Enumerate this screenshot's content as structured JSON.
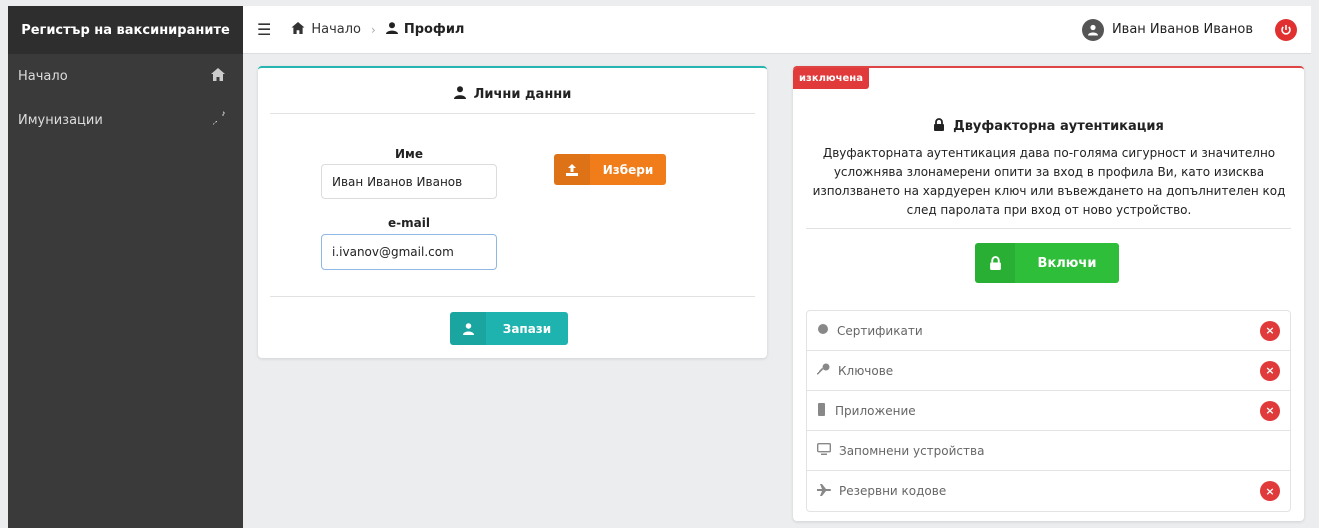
{
  "app": {
    "title": "Регистър на ваксинираните"
  },
  "sidebar": {
    "items": [
      {
        "label": "Начало",
        "icon": "home-icon"
      },
      {
        "label": "Имунизации",
        "icon": "syringe-icon"
      }
    ]
  },
  "topbar": {
    "breadcrumb_home": "Начало",
    "breadcrumb_sep": "›",
    "breadcrumb_current": "Профил",
    "username": "Иван Иванов Иванов"
  },
  "personal": {
    "title": "Лични данни",
    "name_label": "Име",
    "name_value": "Иван Иванов Иванов",
    "email_label": "e-mail",
    "email_value": "i.ivanov@gmail.com",
    "choose_button": "Избери",
    "save_button": "Запази"
  },
  "twofa": {
    "status_badge": "изключена",
    "title": "Двуфакторна аутентикация",
    "description": "Двуфакторната аутентикация дава по-голяма сигурност и значително усложнява злонамерени опити за вход в профила Ви, като изисква използването на хардуерен ключ или въвеждането на допълнителен код след паролата при вход от ново устройство.",
    "enable_button": "Включи",
    "methods": [
      {
        "label": "Сертификати",
        "icon": "certificate-icon",
        "removable": true
      },
      {
        "label": "Ключове",
        "icon": "key-icon",
        "removable": true
      },
      {
        "label": "Приложение",
        "icon": "mobile-app-icon",
        "removable": true
      },
      {
        "label": "Запомнени устройства",
        "icon": "monitor-icon",
        "removable": false
      },
      {
        "label": "Резервни кодове",
        "icon": "airplane-icon",
        "removable": true
      }
    ],
    "remove_glyph": "×"
  },
  "colors": {
    "sidebar_bg": "#3a3a3a",
    "accent_teal": "#1eb3ae",
    "accent_orange": "#f07c1a",
    "accent_green": "#2ebe3a",
    "danger": "#e03a3a"
  }
}
